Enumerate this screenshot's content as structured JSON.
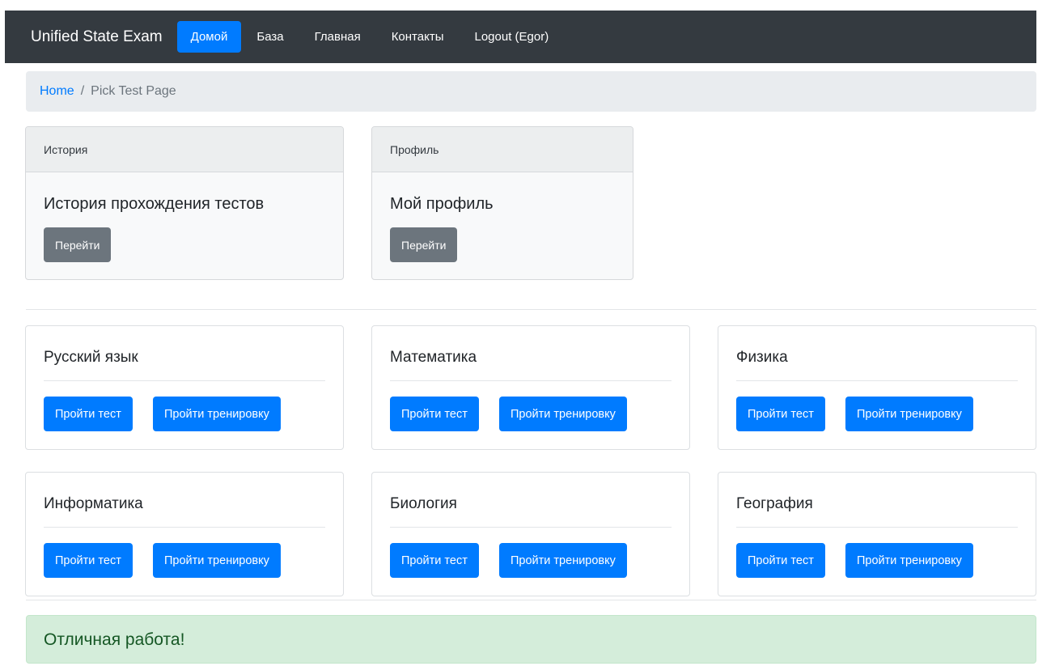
{
  "navbar": {
    "brand": "Unified State Exam",
    "links": [
      "Домой",
      "База",
      "Главная",
      "Контакты",
      "Logout (Egor)"
    ],
    "active_index": 0,
    "bg_color": "#343a40",
    "active_color": "#007bff"
  },
  "breadcrumb": {
    "home": "Home",
    "separator": "/",
    "current": "Pick Test Page"
  },
  "top_cards": [
    {
      "header": "История",
      "title": "История прохождения тестов",
      "button": "Перейти"
    },
    {
      "header": "Профиль",
      "title": "Мой профиль",
      "button": "Перейти"
    }
  ],
  "subjects": [
    {
      "title": "Русский язык",
      "test_btn": "Пройти тест",
      "train_btn": "Пройти тренировку"
    },
    {
      "title": "Математика",
      "test_btn": "Пройти тест",
      "train_btn": "Пройти тренировку"
    },
    {
      "title": "Физика",
      "test_btn": "Пройти тест",
      "train_btn": "Пройти тренировку"
    },
    {
      "title": "Информатика",
      "test_btn": "Пройти тест",
      "train_btn": "Пройти тренировку"
    },
    {
      "title": "Биология",
      "test_btn": "Пройти тест",
      "train_btn": "Пройти тренировку"
    },
    {
      "title": "География",
      "test_btn": "Пройти тест",
      "train_btn": "Пройти тренировку"
    }
  ],
  "alert": {
    "heading": "Отличная работа!",
    "color": "#d4edda"
  }
}
